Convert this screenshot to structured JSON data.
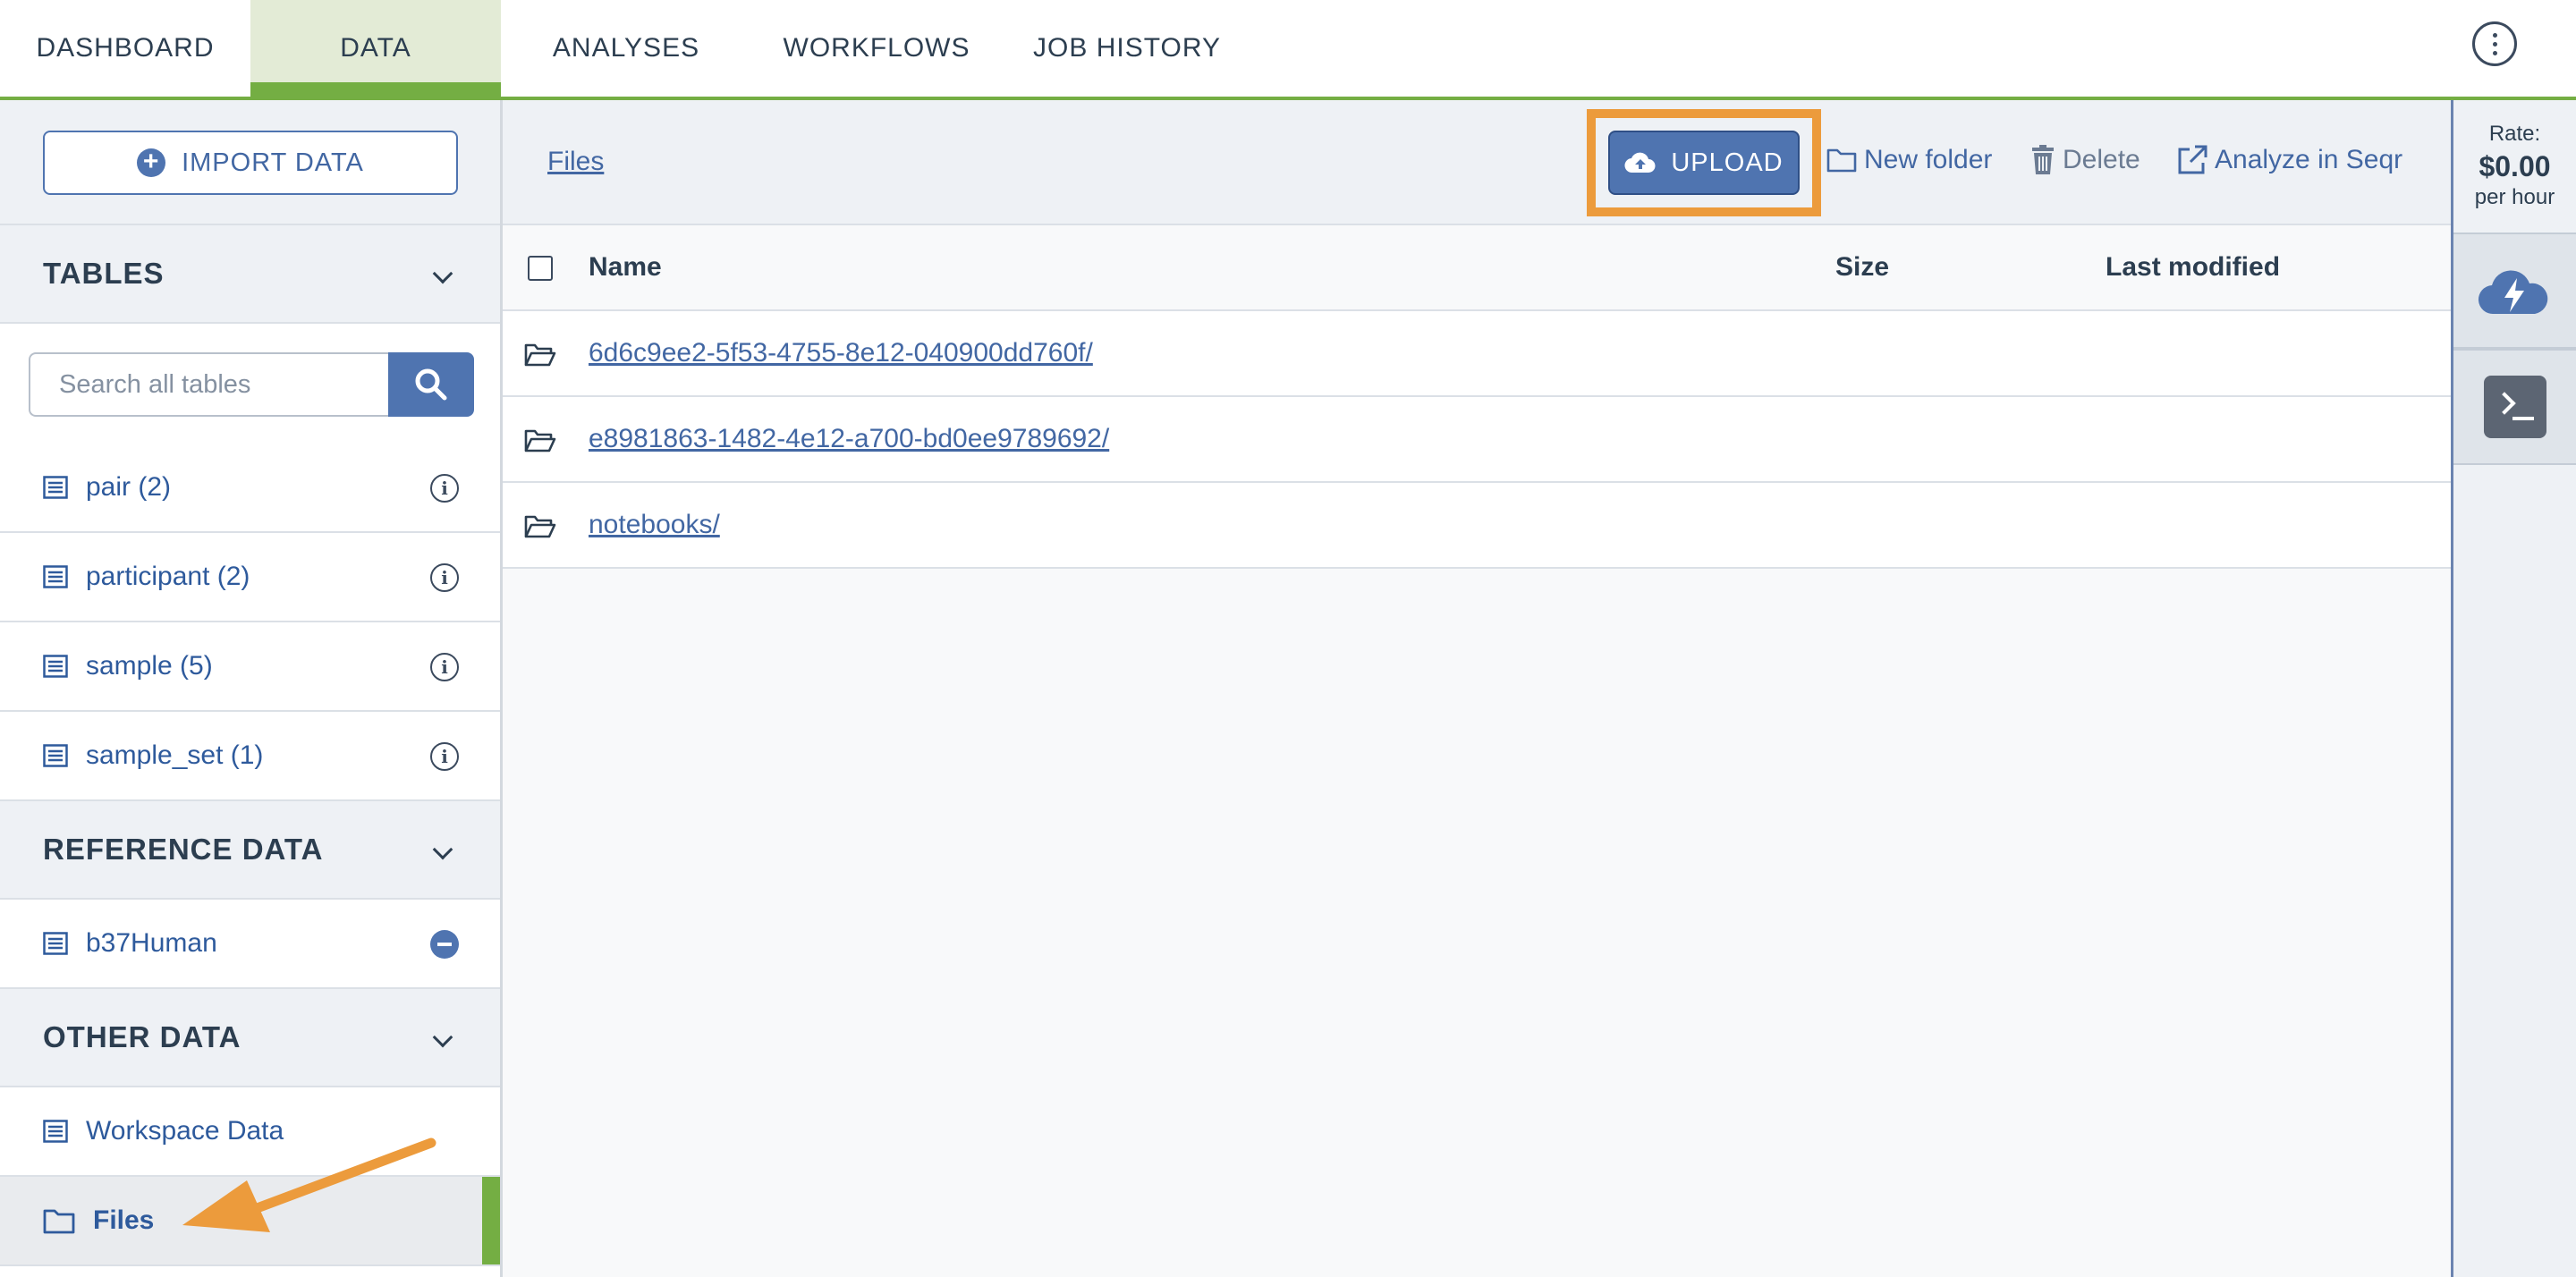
{
  "topnav": {
    "tabs": [
      {
        "label": "DASHBOARD"
      },
      {
        "label": "DATA"
      },
      {
        "label": "ANALYSES"
      },
      {
        "label": "WORKFLOWS"
      },
      {
        "label": "JOB HISTORY"
      }
    ],
    "active_tab": "DATA",
    "menu_icon": "kebab-vertical-icon"
  },
  "sidebar": {
    "import_label": "IMPORT DATA",
    "tables_header": "TABLES",
    "search_placeholder": "Search all tables",
    "tables": [
      {
        "label": "pair  (2)"
      },
      {
        "label": "participant  (2)"
      },
      {
        "label": "sample  (5)"
      },
      {
        "label": "sample_set  (1)"
      }
    ],
    "reference_header": "REFERENCE DATA",
    "reference": [
      {
        "label": "b37Human"
      }
    ],
    "other_header": "OTHER DATA",
    "other": [
      {
        "label": "Workspace Data"
      },
      {
        "label": "Files"
      }
    ],
    "selected": "Files"
  },
  "main": {
    "breadcrumb": "Files",
    "toolbar": {
      "upload": "UPLOAD",
      "new_folder": "New folder",
      "delete": "Delete",
      "analyze": "Analyze in Seqr"
    },
    "columns": {
      "name": "Name",
      "size": "Size",
      "modified": "Last modified"
    },
    "files": [
      {
        "name": "6d6c9ee2-5f53-4755-8e12-040900dd760f/"
      },
      {
        "name": "e8981863-1482-4e12-a700-bd0ee9789692/"
      },
      {
        "name": "notebooks/"
      }
    ]
  },
  "rail": {
    "rate_label": "Rate:",
    "rate_value": "$0.00",
    "rate_unit": "per hour"
  },
  "colors": {
    "accent_green": "#74ae43",
    "primary_blue": "#4f74b0",
    "highlight_orange": "#ec9b3c"
  }
}
